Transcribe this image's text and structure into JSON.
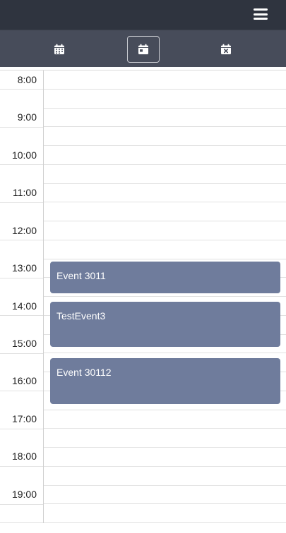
{
  "topbar": {
    "menu_icon": "hamburger-menu-icon",
    "background": "#2f343f"
  },
  "toolbar": {
    "background": "#474c5a",
    "buttons": [
      {
        "name": "month-view",
        "icon": "calendar-grid-icon"
      },
      {
        "name": "day-view",
        "icon": "calendar-day-icon",
        "active": true
      },
      {
        "name": "clear-view",
        "icon": "calendar-x-icon"
      }
    ]
  },
  "calendar": {
    "hours": [
      "8:00",
      "9:00",
      "10:00",
      "11:00",
      "12:00",
      "13:00",
      "14:00",
      "15:00",
      "16:00",
      "17:00",
      "18:00",
      "19:00"
    ],
    "event_color": "#6f7c9c",
    "events": [
      {
        "title": "Event 3011"
      },
      {
        "title": "TestEvent3"
      },
      {
        "title": "Event 30112"
      }
    ]
  }
}
